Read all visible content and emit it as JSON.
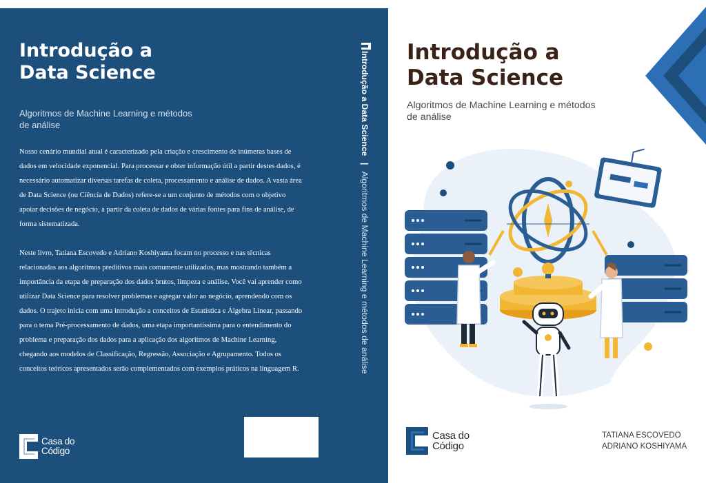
{
  "back_cover": {
    "title_line1": "Introdução a",
    "title_line2": "Data Science",
    "subtitle_line1": "Algoritmos de Machine Learning e métodos",
    "subtitle_line2": "de análise",
    "paragraphs": [
      "Nosso cenário mundial atual é caracterizado pela criação e crescimento de inúmeras bases de dados em velocidade exponencial. Para processar e obter informação útil a partir destes dados, é necessário automatizar diversas tarefas de coleta, processamento e análise de dados. A vasta área de Data Science (ou Ciência de Dados) refere-se a um conjunto de métodos com o objetivo apoiar decisões de negócio, a partir da coleta de dados de várias fontes para fins de análise, de forma sistematizada.",
      "Neste livro, Tatiana Escovedo e Adriano Koshiyama focam no processo e nas técnicas relacionadas aos algoritmos preditivos mais comumente utilizados, mas mostrando também a importância da etapa de preparação dos dados brutos, limpeza e análise. Você vai aprender como utilizar Data Science para resolver problemas e agregar valor ao negócio, aprendendo com os dados. O trajeto inicia com uma introdução a conceitos de Estatística e Álgebra Linear, passando para o tema Pré-processamento de dados, uma etapa importantíssima para o entendimento do problema e preparação dos dados para a aplicação dos algoritmos de Machine Learning, chegando aos modelos de Classificação, Regressão, Associação e Agrupamento. Todos os conceitos teóricos apresentados serão complementados com exemplos práticos na linguagem R."
    ],
    "publisher_line1": "Casa do",
    "publisher_line2": "Código"
  },
  "spine": {
    "title": "Introdução a Data Science",
    "separator": "|",
    "subtitle": "Algoritmos de Machine Learning e métodos de análise"
  },
  "front_cover": {
    "title_line1": "Introdução a",
    "title_line2": "Data Science",
    "subtitle_line1": "Algoritmos de Machine Learning e métodos",
    "subtitle_line2": "de análise",
    "publisher_line1": "Casa do",
    "publisher_line2": "Código",
    "author1": "TATIANA ESCOVEDO",
    "author2": "ADRIANO KOSHIYAMA"
  },
  "colors": {
    "cover_blue": "#1d4f7c",
    "title_brown": "#3b2218",
    "accent_blue": "#2d6fb5",
    "accent_yellow": "#f2b632",
    "server_blue": "#2a5d94"
  },
  "illustration_icons": [
    "server-rack-icon",
    "atom-icon",
    "robot-icon",
    "scientist-icon",
    "monitor-icon",
    "lightbulb-icon"
  ]
}
